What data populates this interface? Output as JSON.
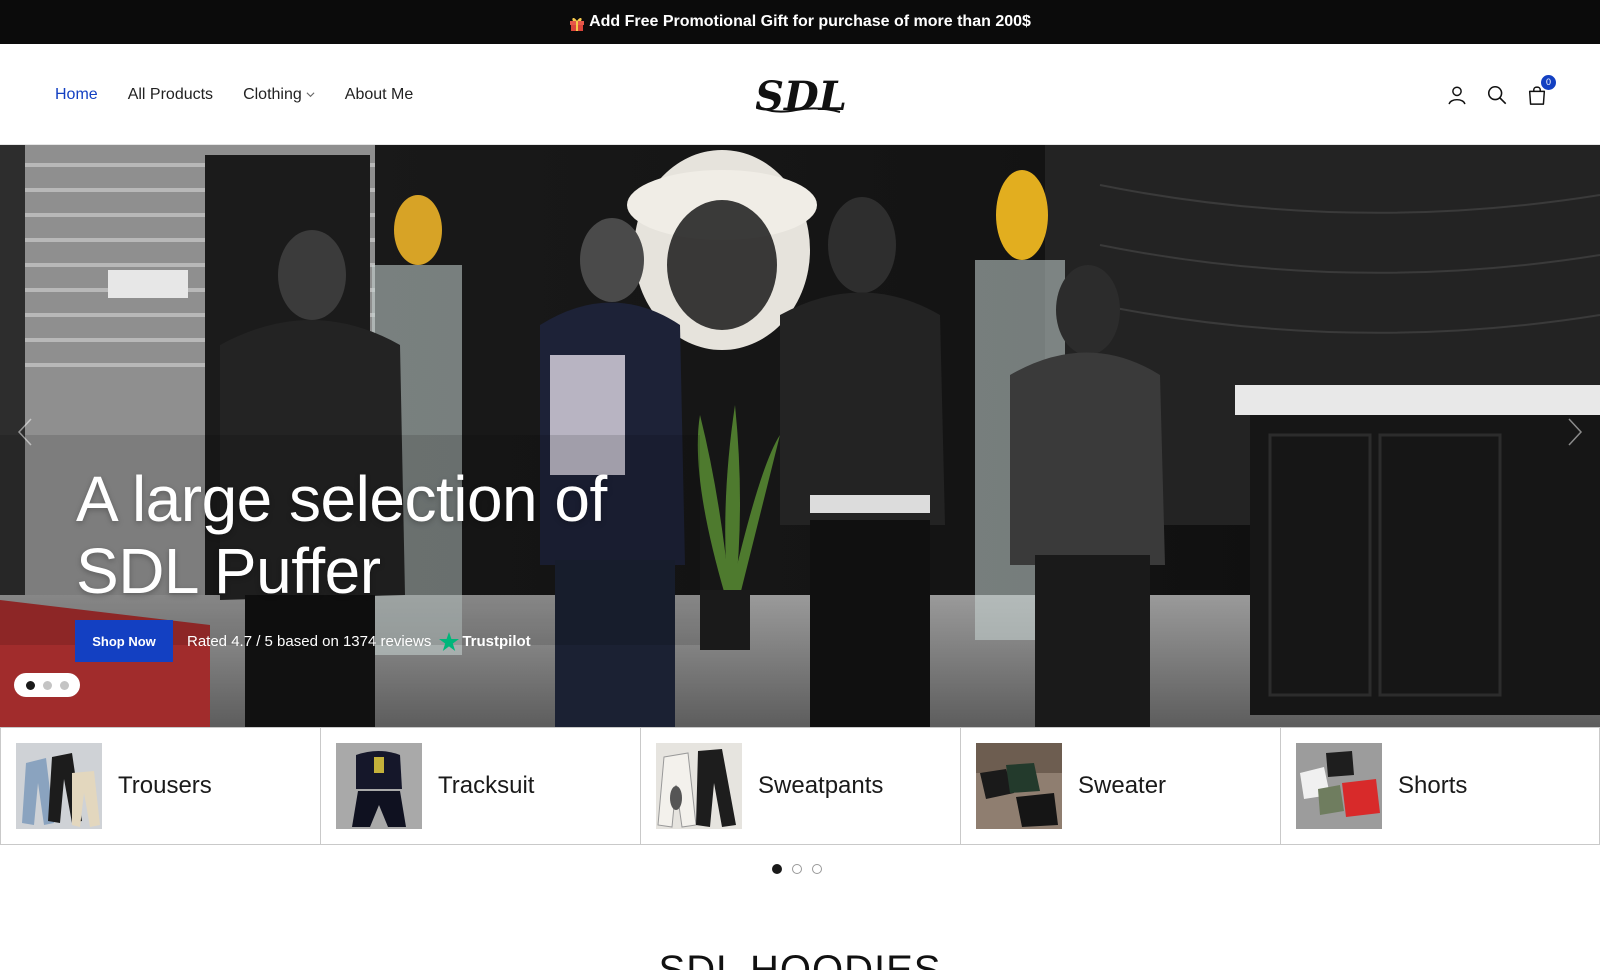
{
  "announcement": {
    "text": "Add Free Promotional Gift for purchase of more than 200$",
    "icon": "gift-icon"
  },
  "nav": {
    "items": [
      {
        "label": "Home",
        "active": true
      },
      {
        "label": "All Products",
        "active": false
      },
      {
        "label": "Clothing",
        "active": false,
        "has_dropdown": true
      },
      {
        "label": "About Me",
        "active": false
      }
    ]
  },
  "logo": {
    "text": "SDL"
  },
  "header_actions": {
    "cart_count": "0",
    "icons": [
      "account-icon",
      "search-icon",
      "cart-icon"
    ]
  },
  "hero": {
    "title_line1": "A large selection of",
    "title_line2": "SDL Puffer",
    "button_label": "Shop Now",
    "rating_text": "Rated 4.7 / 5 based on 1374 reviews",
    "trustpilot_label": "Trustpilot",
    "slide_count": 3,
    "active_slide": 1
  },
  "categories": [
    {
      "label": "Trousers"
    },
    {
      "label": "Tracksuit"
    },
    {
      "label": "Sweatpants"
    },
    {
      "label": "Sweater"
    },
    {
      "label": "Shorts"
    }
  ],
  "categories_pagination": {
    "pages": 3,
    "active": 1
  },
  "section": {
    "title": "SDL HOODIES"
  },
  "colors": {
    "accent": "#1340c2",
    "announcement_bg": "#0b0b0b",
    "trustpilot_star": "#00b67a"
  }
}
